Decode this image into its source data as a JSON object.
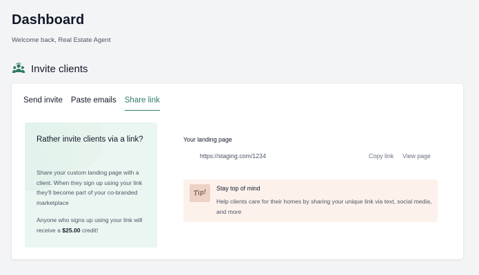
{
  "header": {
    "title": "Dashboard",
    "welcome": "Welcome back, Real Estate Agent"
  },
  "section": {
    "title": "Invite clients",
    "icon": "people-group-icon"
  },
  "tabs": [
    {
      "label": "Send invite",
      "active": false
    },
    {
      "label": "Paste emails",
      "active": false
    },
    {
      "label": "Share link",
      "active": true
    }
  ],
  "promo": {
    "heading": "Rather invite clients via a link?",
    "paragraph1": "Share your custom landing page with a client. When they sign up using your link they'll become part of your co-branded marketplace",
    "paragraph2_prefix": "Anyone who signs up using your link will receive a ",
    "paragraph2_amount": "$25.00",
    "paragraph2_suffix": " credit!"
  },
  "landing": {
    "label": "Your landing page",
    "url": "https://staging.com/1234",
    "copy_label": "Copy link",
    "view_label": "View page"
  },
  "tip": {
    "badge": "Tip!",
    "title": "Stay top of mind",
    "body": "Help clients care for their homes by sharing your unique link via text, social media, and more"
  },
  "colors": {
    "accent": "#2d7a68",
    "promo_bg": "#eaf6f1",
    "tip_bg": "#fdf1ec",
    "page_bg": "#f3f4f6"
  }
}
